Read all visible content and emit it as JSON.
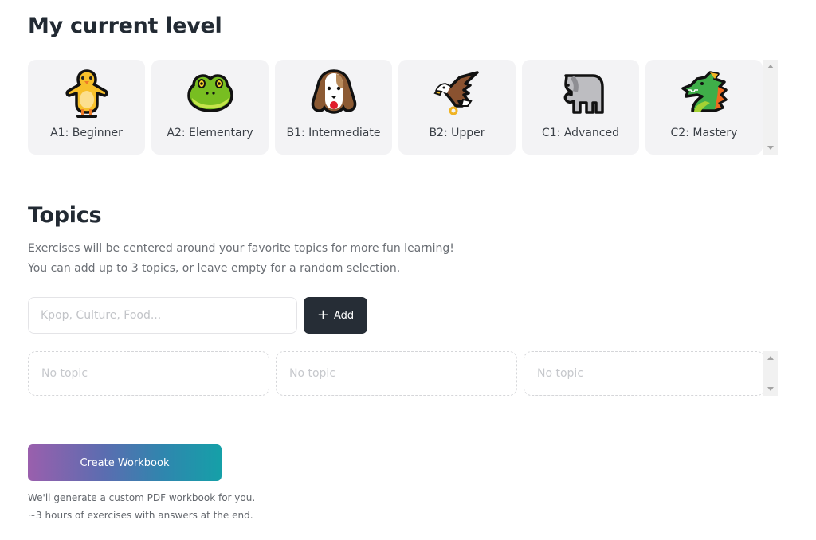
{
  "level_section": {
    "title": "My current level",
    "levels": [
      {
        "label": "A1: Beginner",
        "icon": "chick-icon"
      },
      {
        "label": "A2: Elementary",
        "icon": "frog-icon"
      },
      {
        "label": "B1: Intermediate",
        "icon": "dog-icon"
      },
      {
        "label": "B2: Upper",
        "icon": "eagle-icon"
      },
      {
        "label": "C1: Advanced",
        "icon": "elephant-icon"
      },
      {
        "label": "C2: Mastery",
        "icon": "dragon-icon"
      }
    ]
  },
  "topics_section": {
    "title": "Topics",
    "description_line1": "Exercises will be centered around your favorite topics for more fun learning!",
    "description_line2": "You can add up to 3 topics, or leave empty for a random selection.",
    "input": {
      "placeholder": "Kpop, Culture, Food...",
      "value": ""
    },
    "add_button": {
      "icon": "+",
      "label": "Add"
    },
    "slots": [
      "No topic",
      "No topic",
      "No topic"
    ]
  },
  "create": {
    "button_label": "Create Workbook",
    "note_line1": "We'll generate a custom PDF workbook for you.",
    "note_line2": "~3 hours of exercises with answers at the end."
  }
}
